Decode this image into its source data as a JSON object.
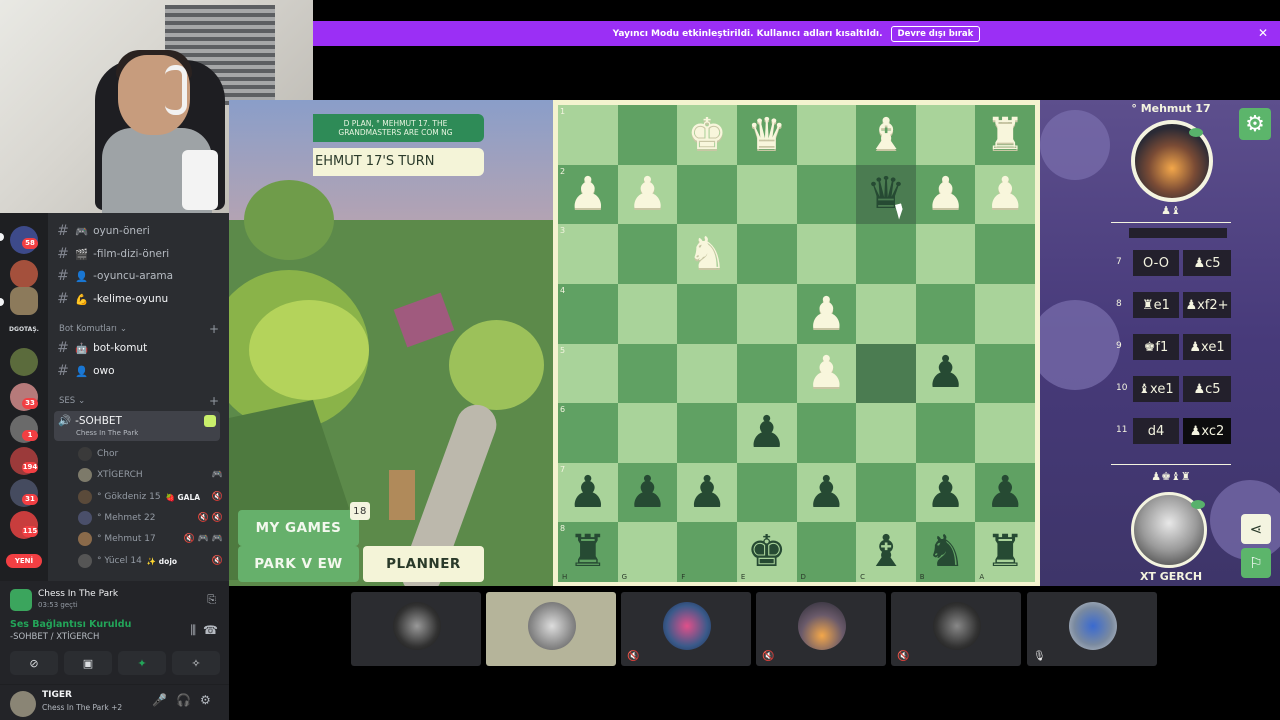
{
  "banner": {
    "text": "Yayıncı Modu etkinleştirildi. Kullanıcı adları kısaltıldı.",
    "button": "Devre dışı bırak",
    "close": "✕"
  },
  "discord": {
    "rail": {
      "badges": [
        "58",
        "33",
        "1",
        "194",
        "31",
        "115"
      ],
      "label": "DGOTAŞ.",
      "new_label": "YENİ"
    },
    "channels": [
      {
        "icon": "🎮",
        "name": "oyun-öneri"
      },
      {
        "icon": "🎬",
        "name": "-film-dizi-öneri"
      },
      {
        "icon": "👤",
        "name": "-oyuncu-arama"
      },
      {
        "icon": "💪",
        "name": "-kelime-oyunu"
      }
    ],
    "category_bot": "Bot Komutları",
    "bot_channels": [
      {
        "icon": "🤖",
        "name": "bot-komut"
      },
      {
        "icon": "👤",
        "name": "owo"
      }
    ],
    "category_voice": "SES",
    "active_voice": {
      "name": "-SOHBET",
      "activity": "Chess In The Park"
    },
    "members": [
      {
        "name": "Chor",
        "badge": "",
        "right": ""
      },
      {
        "name": "XTİGERCH",
        "badge": "",
        "right": "🎮"
      },
      {
        "name": "° Gökdeniz 15",
        "badge": "🍓 GALA",
        "right": "🔇"
      },
      {
        "name": "° Mehmet 22",
        "badge": "",
        "right": "🔇 🔇"
      },
      {
        "name": "° Mehmut 17",
        "badge": "",
        "right": "🔇 🎮 🎮"
      },
      {
        "name": "° Yücel 14",
        "badge": "✨ dojo",
        "right": "🔇"
      }
    ],
    "activity_panel": {
      "name": "Chess In The Park",
      "time": "03:53 geçti"
    },
    "connection": {
      "status": "Ses Bağlantısı Kuruldu",
      "channel": "-SOHBET / XTİGERCH"
    },
    "user": {
      "name": "TIGER",
      "status": "Chess In The Park +2"
    }
  },
  "game": {
    "top_banner": "D PLAN, ° MEHMUT 17. THE GRANDMASTERS ARE COM NG",
    "turn": "EHMUT 17'S TURN",
    "my_games": "MY GAMES",
    "my_games_count": "18",
    "park_view": "PARK V EW",
    "planner": "PLANNER",
    "player_top": "° Mehmut 17",
    "player_bottom": "XT GERCH",
    "captured_top": "♟♝",
    "captured_bottom": "♟♚♝♜",
    "moves": [
      {
        "n": "7",
        "w": "O-O",
        "b": "♟c5"
      },
      {
        "n": "8",
        "w": "♜e1",
        "b": "♟xf2+"
      },
      {
        "n": "9",
        "w": "♚f1",
        "b": "♟xe1"
      },
      {
        "n": "10",
        "w": "♝xe1",
        "b": "♟c5"
      },
      {
        "n": "11",
        "w": "d4",
        "b": "♟xc2"
      }
    ],
    "board": [
      [
        "",
        "",
        "wK",
        "wQ",
        "",
        "wB",
        "",
        "wR"
      ],
      [
        "wP",
        "wP",
        "",
        "",
        "",
        "bQ",
        "wP",
        "wP"
      ],
      [
        "",
        "",
        "wN",
        "",
        "",
        "",
        "",
        ""
      ],
      [
        "",
        "",
        "",
        "",
        "wP",
        "",
        "",
        ""
      ],
      [
        "",
        "",
        "",
        "",
        "wP",
        "",
        "bP",
        ""
      ],
      [
        "",
        "",
        "",
        "bP",
        "",
        "",
        "",
        ""
      ],
      [
        "bP",
        "bP",
        "bP",
        "",
        "bP",
        "",
        "bP",
        "bP"
      ],
      [
        "bR",
        "",
        "",
        "bK",
        "",
        "bB",
        "bN",
        "bR"
      ]
    ],
    "ranks": [
      "1",
      "2",
      "3",
      "4",
      "5",
      "6",
      "7",
      "8"
    ],
    "files": [
      "H",
      "G",
      "F",
      "E",
      "D",
      "C",
      "B",
      "A"
    ]
  },
  "tiles_count": 6
}
